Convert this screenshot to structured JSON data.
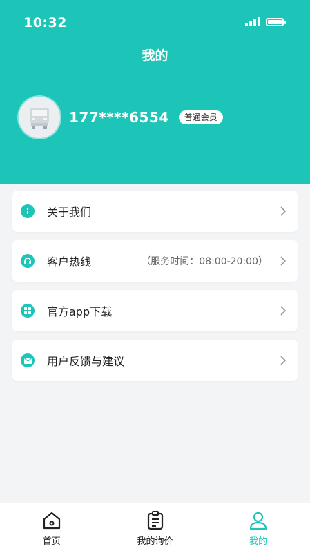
{
  "status_bar": {
    "time": "10:32"
  },
  "header": {
    "title": "我的"
  },
  "profile": {
    "phone": "177****6554",
    "badge": "普通会员"
  },
  "menu": [
    {
      "label": "关于我们",
      "icon": "info-icon",
      "extra": ""
    },
    {
      "label": "客户热线",
      "icon": "hotline-icon",
      "extra": "（服务时间：08:00-20:00）"
    },
    {
      "label": "官方app下载",
      "icon": "app-grid-icon",
      "extra": ""
    },
    {
      "label": "用户反馈与建议",
      "icon": "mail-icon",
      "extra": ""
    }
  ],
  "tabbar": [
    {
      "label": "首页",
      "icon": "home-icon",
      "active": false
    },
    {
      "label": "我的询价",
      "icon": "clipboard-icon",
      "active": false
    },
    {
      "label": "我的",
      "icon": "user-icon",
      "active": true
    }
  ],
  "colors": {
    "accent": "#1cc5b7",
    "background": "#f3f4f6"
  }
}
